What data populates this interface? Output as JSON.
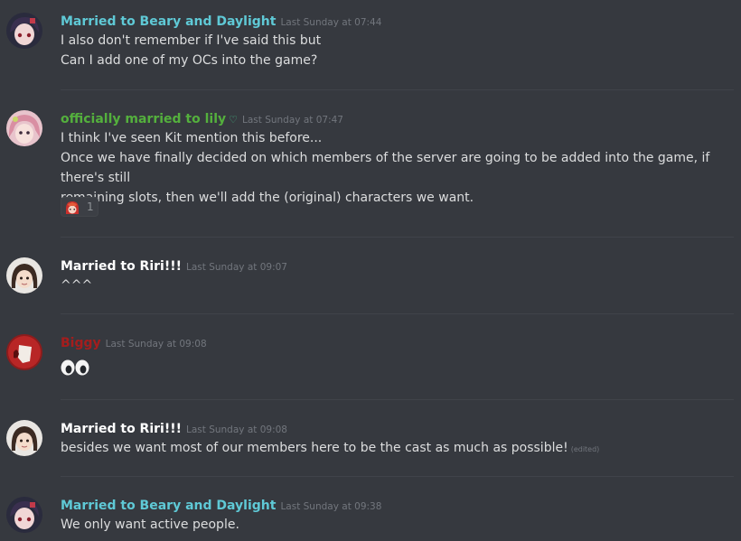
{
  "colors": {
    "background": "#36393f",
    "username_cyan": "#5fc9d6",
    "username_green": "#54b03d",
    "username_white": "#ffffff",
    "username_red": "#a51d1d",
    "timestamp": "#72767d",
    "text": "#dcddde"
  },
  "messages": [
    {
      "username": "Married to Beary and Daylight",
      "timestamp": "Last Sunday at 07:44",
      "lines": [
        "I also don't remember if I've said this but",
        "Can I add one of my OCs into the game?"
      ],
      "avatar": "dark-haired-character-avatar"
    },
    {
      "username": "officially married to lily",
      "username_icon": "heart-outline-icon",
      "heart_glyph": "♡",
      "timestamp": "Last Sunday at 07:47",
      "lines": [
        "I think I've seen Kit mention this before...",
        "Once we have finally decided on which members of the server are going to be added into the game, if there's still",
        "remaining slots, then we'll add the (original) characters we want."
      ],
      "avatar": "pink-haired-character-avatar",
      "reaction": {
        "emoji": "red-haired-character-emoji",
        "count": "1"
      }
    },
    {
      "username": "Married to Riri!!!",
      "timestamp": "Last Sunday at 09:07",
      "lines": [
        "^^^"
      ],
      "avatar": "brown-haired-character-avatar"
    },
    {
      "username": "Biggy",
      "timestamp": "Last Sunday at 09:08",
      "emoji": "eyes-emoji",
      "avatar": "red-white-abstract-avatar"
    },
    {
      "username": "Married to Riri!!!",
      "timestamp": "Last Sunday at 09:08",
      "lines": [
        "besides we want most of our members here to be the cast as much as possible!"
      ],
      "edited_label": "(edited)",
      "avatar": "brown-haired-character-avatar"
    },
    {
      "username": "Married to Beary and Daylight",
      "timestamp": "Last Sunday at 09:38",
      "lines": [
        "We only want active people."
      ],
      "avatar": "dark-haired-character-avatar"
    }
  ]
}
